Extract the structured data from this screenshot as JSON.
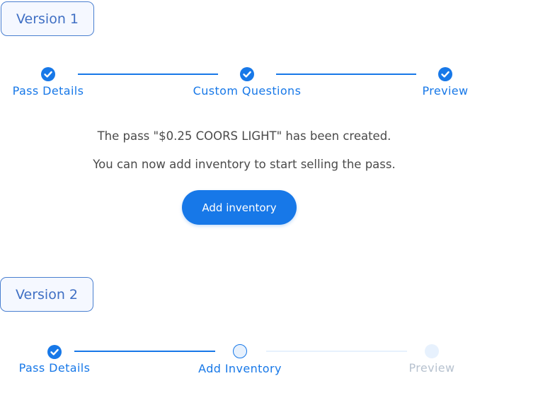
{
  "colors": {
    "accent": "#1778e8",
    "pending": "#e7f1fd",
    "muted_text": "#b7c2cf",
    "tag_border": "#4a7fd0"
  },
  "version1": {
    "tag": "Version 1",
    "steps": [
      {
        "label": "Pass Details",
        "state": "done",
        "icon": "checkmark-icon"
      },
      {
        "label": "Custom Questions",
        "state": "done",
        "icon": "checkmark-icon"
      },
      {
        "label": "Preview",
        "state": "done",
        "icon": "checkmark-icon"
      }
    ],
    "message_line1": "The pass \"$0.25 COORS LIGHT\" has been created.",
    "message_line2": "You can now add inventory to start selling the pass.",
    "button_label": "Add inventory"
  },
  "version2": {
    "tag": "Version 2",
    "steps": [
      {
        "label": "Pass Details",
        "state": "done",
        "icon": "checkmark-icon"
      },
      {
        "label": "Add Inventory",
        "state": "current"
      },
      {
        "label": "Preview",
        "state": "pending"
      }
    ]
  }
}
